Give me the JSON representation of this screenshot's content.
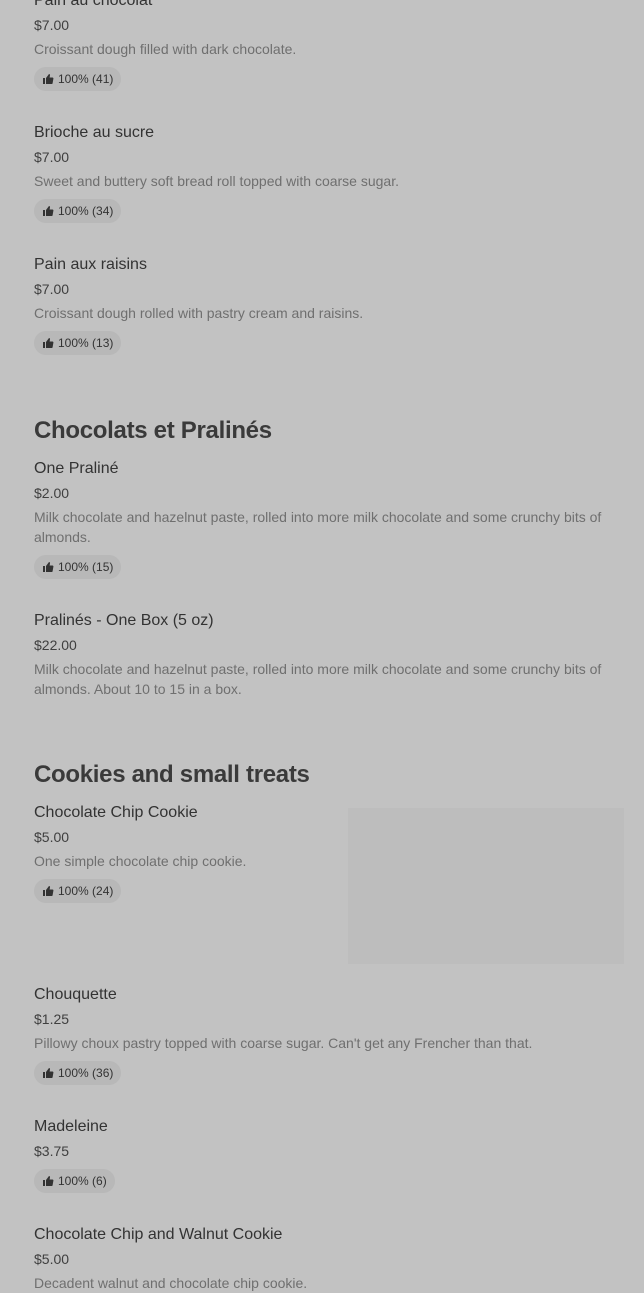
{
  "sections": [
    {
      "items": [
        {
          "name": "Pain au chocolat",
          "price": "$7.00",
          "description": "Croissant dough filled with dark chocolate.",
          "rating": "100% (41)"
        },
        {
          "name": "Brioche au sucre",
          "price": "$7.00",
          "description": "Sweet and buttery soft bread roll topped with coarse sugar.",
          "rating": "100% (34)"
        },
        {
          "name": "Pain aux raisins",
          "price": "$7.00",
          "description": "Croissant dough rolled with pastry cream and raisins.",
          "rating": "100% (13)"
        }
      ]
    },
    {
      "title": "Chocolats et Pralinés",
      "items": [
        {
          "name": "One Praliné",
          "price": "$2.00",
          "description": "Milk chocolate and hazelnut paste, rolled into more milk chocolate and some crunchy bits of almonds.",
          "rating": "100% (15)"
        },
        {
          "name": "Pralinés - One Box (5 oz)",
          "price": "$22.00",
          "description": "Milk chocolate and hazelnut paste, rolled into more milk chocolate and some crunchy bits of almonds. About 10 to 15 in a box."
        }
      ]
    },
    {
      "title": "Cookies and small treats",
      "items": [
        {
          "name": "Chocolate Chip Cookie",
          "price": "$5.00",
          "description": "One simple chocolate chip cookie.",
          "rating": "100% (24)"
        },
        {
          "name": "Chouquette",
          "price": "$1.25",
          "description": "Pillowy choux pastry topped with coarse sugar. Can't get any Frencher than that.",
          "rating": "100% (36)"
        },
        {
          "name": "Madeleine",
          "price": "$3.75",
          "rating": "100% (6)"
        },
        {
          "name": "Chocolate Chip and Walnut Cookie",
          "price": "$5.00",
          "description": "Decadent walnut and chocolate chip cookie."
        }
      ]
    }
  ],
  "icons": {
    "rating": "thumbs-up-icon"
  }
}
